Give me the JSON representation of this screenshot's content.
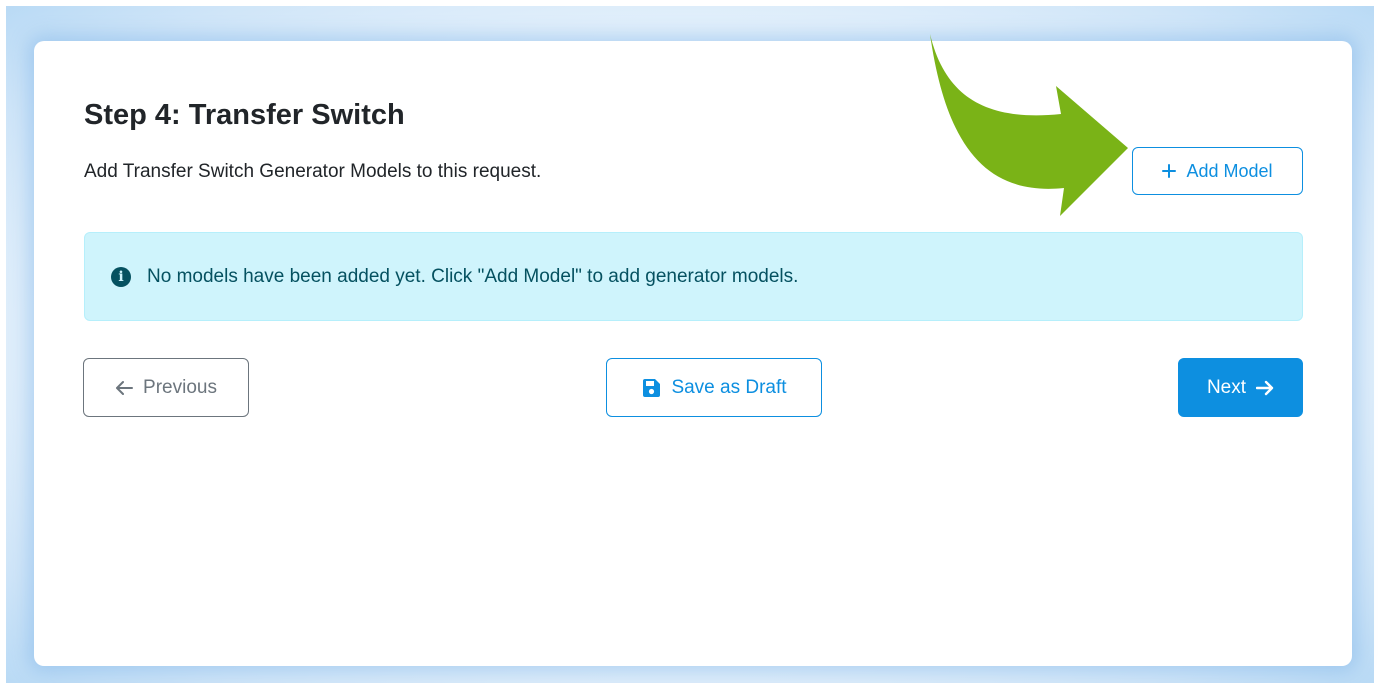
{
  "step": {
    "title": "Step 4: Transfer Switch",
    "subtitle": "Add Transfer Switch Generator Models to this request."
  },
  "add_model": {
    "label": "Add Model",
    "icon": "plus-icon"
  },
  "alert": {
    "icon": "info-circle-icon",
    "text": "No models have been added yet. Click \"Add Model\" to add generator models."
  },
  "nav": {
    "previous_label": "Previous",
    "previous_icon": "arrow-left-icon",
    "draft_label": "Save as Draft",
    "draft_icon": "floppy-disk-icon",
    "next_label": "Next",
    "next_icon": "arrow-right-icon"
  },
  "colors": {
    "primary": "#0d8fe0",
    "secondary": "#6c757d",
    "alert_bg": "#cff4fc",
    "alert_text": "#055160",
    "annotation_arrow": "#7ab317"
  }
}
